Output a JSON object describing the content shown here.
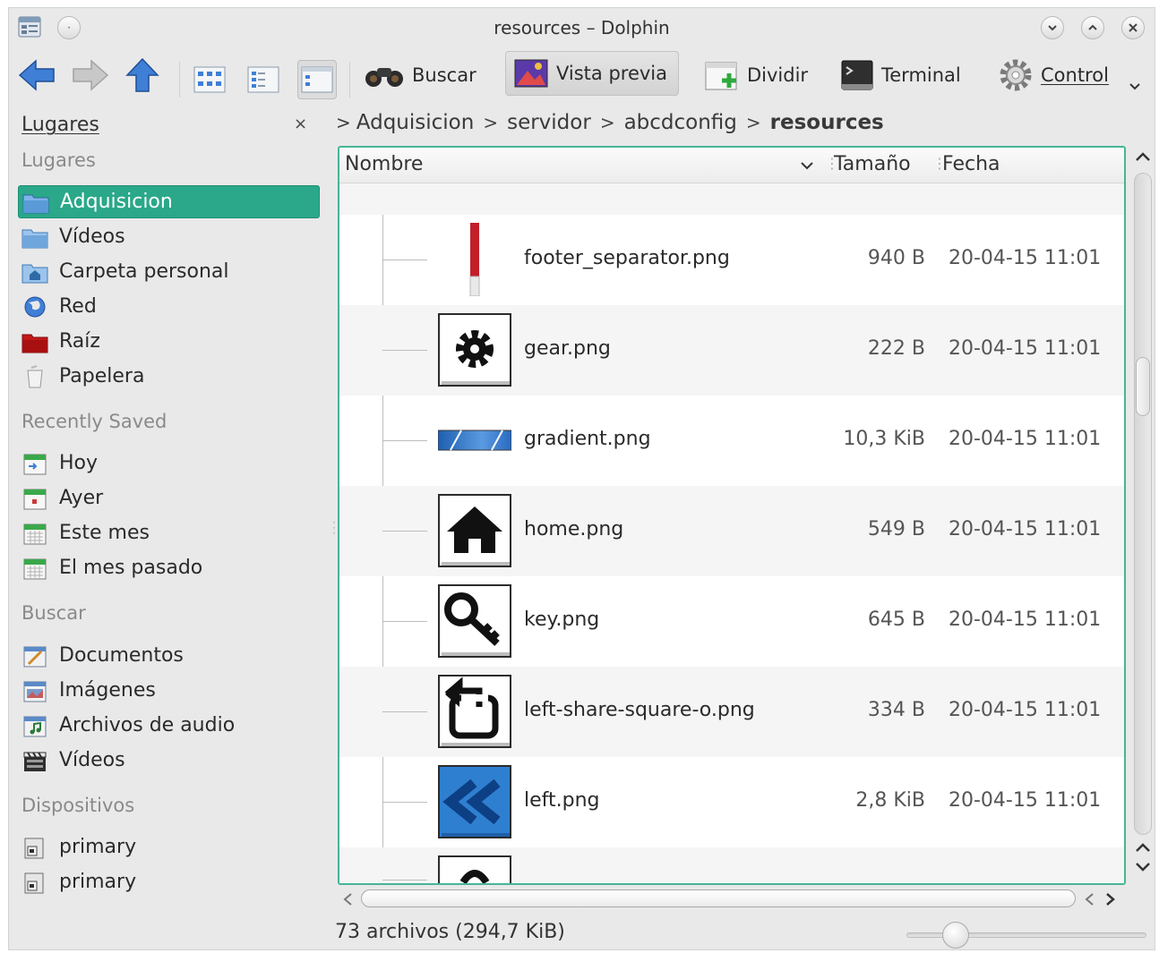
{
  "window": {
    "title": "resources – Dolphin",
    "controls": [
      "minimize",
      "maximize",
      "close"
    ]
  },
  "toolbar": {
    "back": "back-arrow-icon",
    "forward": "forward-arrow-icon",
    "up": "up-arrow-icon",
    "views": [
      "icons-view",
      "compact-view",
      "details-view"
    ],
    "active_view": "details-view",
    "search_label": "Buscar",
    "preview_label": "Vista previa",
    "split_label": "Dividir",
    "terminal_label": "Terminal",
    "control_label": "Control"
  },
  "sidebar": {
    "panel_title": "Lugares",
    "close_glyph": "×",
    "sections": {
      "places": "Lugares",
      "recent": "Recently Saved",
      "search": "Buscar",
      "devices": "Dispositivos"
    },
    "places": [
      {
        "label": "Adquisicion",
        "icon": "folder-icon",
        "selected": true
      },
      {
        "label": "Vídeos",
        "icon": "folder-icon"
      },
      {
        "label": "Carpeta personal",
        "icon": "home-folder-icon"
      },
      {
        "label": "Red",
        "icon": "network-globe-icon"
      },
      {
        "label": "Raíz",
        "icon": "root-folder-icon"
      },
      {
        "label": "Papelera",
        "icon": "trash-icon"
      }
    ],
    "recent": [
      {
        "label": "Hoy",
        "icon": "calendar-today-icon"
      },
      {
        "label": "Ayer",
        "icon": "calendar-yesterday-icon"
      },
      {
        "label": "Este mes",
        "icon": "calendar-month-icon"
      },
      {
        "label": "El mes pasado",
        "icon": "calendar-last-month-icon"
      }
    ],
    "search": [
      {
        "label": "Documentos",
        "icon": "documents-icon"
      },
      {
        "label": "Imágenes",
        "icon": "images-icon"
      },
      {
        "label": "Archivos de audio",
        "icon": "audio-files-icon"
      },
      {
        "label": "Vídeos",
        "icon": "videos-clapper-icon"
      }
    ],
    "devices": [
      {
        "label": "primary",
        "icon": "drive-icon"
      },
      {
        "label": "primary",
        "icon": "drive-icon"
      }
    ]
  },
  "breadcrumb": {
    "lead_arrow": ">",
    "sep": ">",
    "items": [
      "Adquisicion",
      "servidor",
      "abcdconfig"
    ],
    "current": "resources"
  },
  "columns": {
    "name": "Nombre",
    "size": "Tamaño",
    "date": "Fecha",
    "sort_indicator": "chevron-down-icon"
  },
  "files": [
    {
      "name": "footer_separator.png",
      "size": "940 B",
      "date": "20-04-15 11:01",
      "icon": "red-bar-thumbnail"
    },
    {
      "name": "gear.png",
      "size": "222 B",
      "date": "20-04-15 11:01",
      "icon": "gear-icon"
    },
    {
      "name": "gradient.png",
      "size": "10,3 KiB",
      "date": "20-04-15 11:01",
      "icon": "blue-gradient-thumbnail"
    },
    {
      "name": "home.png",
      "size": "549 B",
      "date": "20-04-15 11:01",
      "icon": "home-icon"
    },
    {
      "name": "key.png",
      "size": "645 B",
      "date": "20-04-15 11:01",
      "icon": "key-icon"
    },
    {
      "name": "left-share-square-o.png",
      "size": "334 B",
      "date": "20-04-15 11:01",
      "icon": "share-square-icon"
    },
    {
      "name": "left.png",
      "size": "2,8 KiB",
      "date": "20-04-15 11:01",
      "icon": "double-left-icon"
    }
  ],
  "status": {
    "summary": "73 archivos (294,7 KiB)"
  },
  "colors": {
    "selection": "#2aa889",
    "focus_border": "#47b596",
    "window_bg": "#e9e9e9"
  }
}
